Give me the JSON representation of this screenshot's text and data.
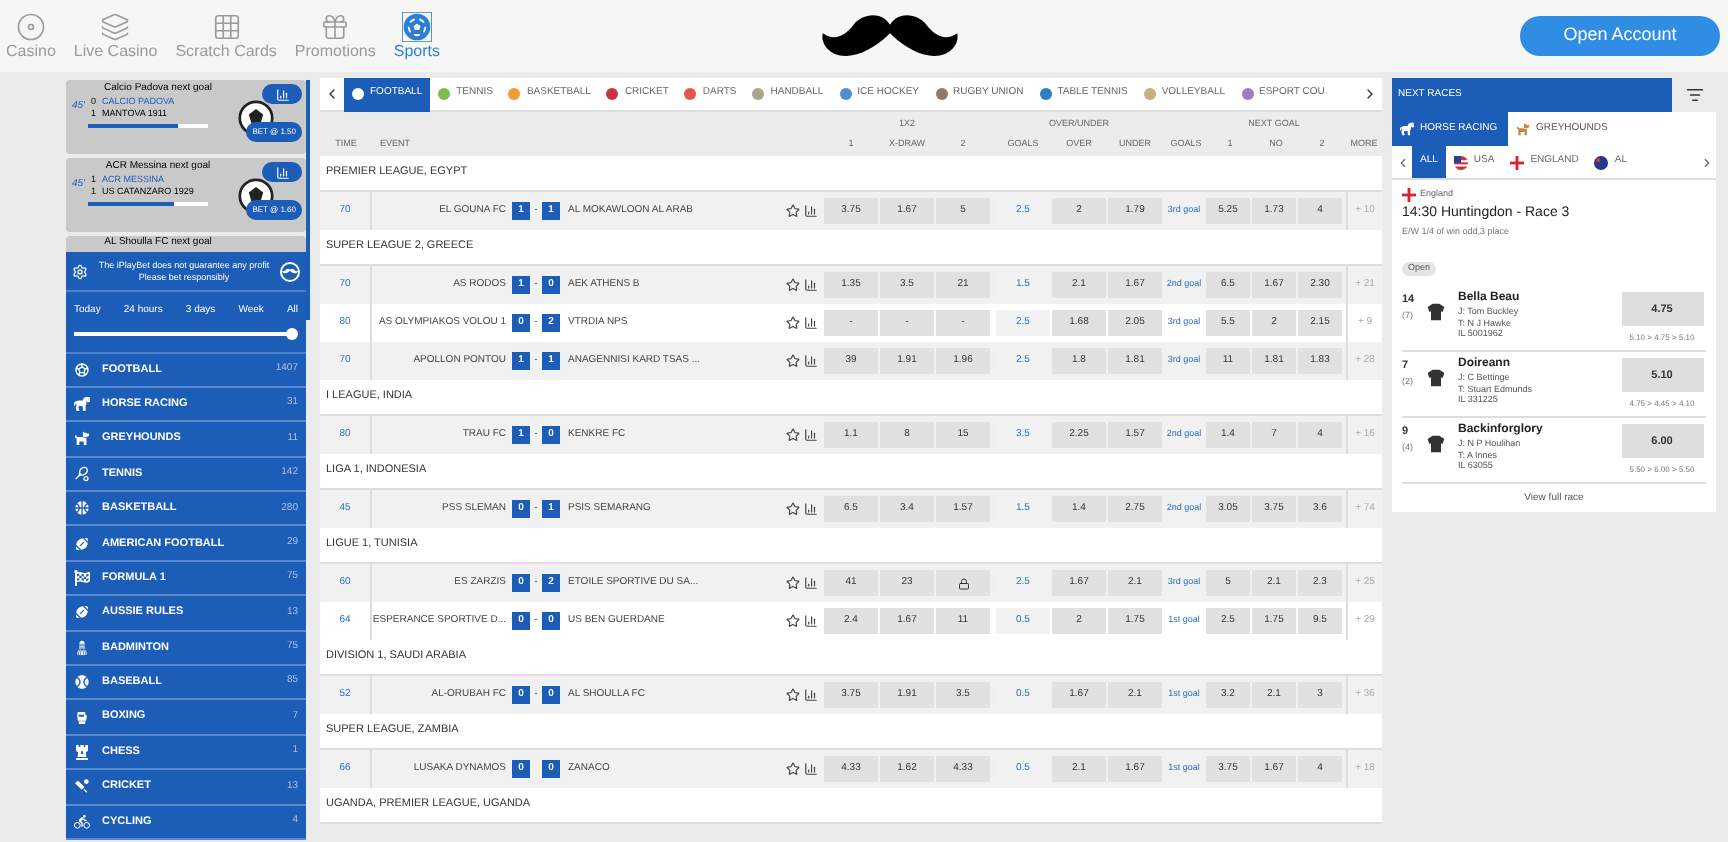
{
  "top_nav": [
    {
      "label": "Casino",
      "kind": "casino",
      "selected": false
    },
    {
      "label": "Live Casino",
      "kind": "cards",
      "selected": false
    },
    {
      "label": "Scratch Cards",
      "kind": "grid",
      "selected": false
    },
    {
      "label": "Promotions",
      "kind": "gift",
      "selected": false
    },
    {
      "label": "Sports",
      "kind": "sports",
      "selected": true
    }
  ],
  "open_account": "Open Account",
  "live_widgets": [
    {
      "title": "Calcio Padova next goal",
      "minute": "45'",
      "home_score": "0",
      "home": "CALCIO PADOVA",
      "away_score": "1",
      "away": "MANTOVA 1911",
      "bet": "BET @ 1.50",
      "level": 0.75
    },
    {
      "title": "ACR Messina next goal",
      "minute": "45'",
      "home_score": "1",
      "home": "ACR MESSINA",
      "away_score": "1",
      "away": "US CATANZARO 1929",
      "bet": "BET @ 1.60",
      "level": 0.72
    }
  ],
  "covered_widget": {
    "title": "AL Shoulla FC next goal"
  },
  "notice": "The iPlayBet does not guarantee any profit Please bet responsibly",
  "time_filter": {
    "options": [
      "Today",
      "24 hours",
      "3 days",
      "Week",
      "All"
    ],
    "level": 1
  },
  "sports": [
    {
      "label": "FOOTBALL",
      "count": "1407",
      "kind": "football"
    },
    {
      "label": "HORSE RACING",
      "count": "31",
      "kind": "horse"
    },
    {
      "label": "GREYHOUNDS",
      "count": "11",
      "kind": "dog"
    },
    {
      "label": "TENNIS",
      "count": "142",
      "kind": "tennis"
    },
    {
      "label": "BASKETBALL",
      "count": "280",
      "kind": "basketball"
    },
    {
      "label": "AMERICAN FOOTBALL",
      "count": "29",
      "kind": "rugby"
    },
    {
      "label": "FORMULA 1",
      "count": "75",
      "kind": "flag"
    },
    {
      "label": "AUSSIE RULES",
      "count": "13",
      "kind": "rugby"
    },
    {
      "label": "BADMINTON",
      "count": "75",
      "kind": "shuttle"
    },
    {
      "label": "BASEBALL",
      "count": "85",
      "kind": "baseball"
    },
    {
      "label": "BOXING",
      "count": "7",
      "kind": "boxing"
    },
    {
      "label": "CHESS",
      "count": "1",
      "kind": "chess"
    },
    {
      "label": "CRICKET",
      "count": "13",
      "kind": "cricket"
    },
    {
      "label": "CYCLING",
      "count": "4",
      "kind": "cycling"
    }
  ],
  "sport_tabs": [
    {
      "label": "FOOTBALL",
      "selected": true,
      "color": "#ffffff"
    },
    {
      "label": "TENNIS",
      "selected": false,
      "color": "#7cc04b"
    },
    {
      "label": "BASKETBALL",
      "selected": false,
      "color": "#f39a34"
    },
    {
      "label": "CRICKET",
      "selected": false,
      "color": "#cc3340"
    },
    {
      "label": "DARTS",
      "selected": false,
      "color": "#e2564f"
    },
    {
      "label": "HANDBALL",
      "selected": false,
      "color": "#a8a58a"
    },
    {
      "label": "ICE HOCKEY",
      "selected": false,
      "color": "#4f8fd0"
    },
    {
      "label": "RUGBY UNION",
      "selected": false,
      "color": "#8d7a6a"
    },
    {
      "label": "TABLE TENNIS",
      "selected": false,
      "color": "#2e7fc1"
    },
    {
      "label": "VOLLEYBALL",
      "selected": false,
      "color": "#c8b07a"
    },
    {
      "label": "ESPORT COU",
      "selected": false,
      "color": "#9b7cc0"
    }
  ],
  "column_groups": [
    "1X2",
    "OVER/UNDER",
    "NEXT GOAL"
  ],
  "columns": [
    "TIME",
    "EVENT",
    "1",
    "X-DRAW",
    "2",
    "GOALS",
    "OVER",
    "UNDER",
    "GOALS",
    "1",
    "NO",
    "2",
    "MORE"
  ],
  "leagues": [
    {
      "name": "PREMIER LEAGUE, EGYPT",
      "matches": [
        {
          "time": "70",
          "home": "EL GOUNA FC",
          "score_home": "1",
          "separator": "-",
          "score_away": "1",
          "away": "AL MOKAWLOON AL ARAB",
          "odds": [
            {
              "value": "3.75",
              "locked": false
            },
            {
              "value": "1.67",
              "locked": false
            },
            {
              "value": "5",
              "locked": false
            }
          ],
          "goals": "2.5",
          "over": "2",
          "under": "1.79",
          "next_goal": "3rd goal",
          "next": [
            "5.25",
            "1.73",
            "4"
          ],
          "more": "+ 10"
        }
      ]
    },
    {
      "name": "SUPER LEAGUE 2, GREECE",
      "matches": [
        {
          "time": "70",
          "home": "AS RODOS",
          "score_home": "1",
          "separator": "-",
          "score_away": "0",
          "away": "AEK ATHENS B",
          "odds": [
            {
              "value": "1.35",
              "locked": false
            },
            {
              "value": "3.5",
              "locked": false
            },
            {
              "value": "21",
              "locked": false
            }
          ],
          "goals": "1.5",
          "over": "2.1",
          "under": "1.67",
          "next_goal": "2nd goal",
          "next": [
            "6.5",
            "1.67",
            "2.30"
          ],
          "more": "+ 21"
        },
        {
          "time": "80",
          "home": "AS OLYMPIAKOS VOLOU 1",
          "score_home": "0",
          "separator": "-",
          "score_away": "2",
          "away": "VTRDIA NPS",
          "odds": [
            {
              "value": "-",
              "locked": false
            },
            {
              "value": "-",
              "locked": false
            },
            {
              "value": "-",
              "locked": false
            }
          ],
          "goals": "2.5",
          "over": "1.68",
          "under": "2.05",
          "next_goal": "3rd goal",
          "next": [
            "5.5",
            "2",
            "2.15"
          ],
          "more": "+ 9"
        },
        {
          "time": "70",
          "home": "APOLLON PONTOU",
          "score_home": "1",
          "separator": "-",
          "score_away": "1",
          "away": "ANAGENNISI KARD TSAS ...",
          "odds": [
            {
              "value": "39",
              "locked": false
            },
            {
              "value": "1.91",
              "locked": false
            },
            {
              "value": "1.96",
              "locked": false
            }
          ],
          "goals": "2.5",
          "over": "1.8",
          "under": "1.81",
          "next_goal": "3rd goal",
          "next": [
            "11",
            "1.81",
            "1.83"
          ],
          "more": "+ 28"
        }
      ]
    },
    {
      "name": "I LEAGUE, INDIA",
      "matches": [
        {
          "time": "80",
          "home": "TRAU FC",
          "score_home": "1",
          "separator": "-",
          "score_away": "0",
          "away": "KENKRE FC",
          "odds": [
            {
              "value": "1.1",
              "locked": false
            },
            {
              "value": "8",
              "locked": false
            },
            {
              "value": "15",
              "locked": false
            }
          ],
          "goals": "3.5",
          "over": "2.25",
          "under": "1.57",
          "next_goal": "2nd goal",
          "next": [
            "1.4",
            "7",
            "4"
          ],
          "more": "+ 16"
        }
      ]
    },
    {
      "name": "LIGA 1, INDONESIA",
      "matches": [
        {
          "time": "45",
          "home": "PSS SLEMAN",
          "score_home": "0",
          "separator": "-",
          "score_away": "1",
          "away": "PSIS SEMARANG",
          "odds": [
            {
              "value": "6.5",
              "locked": false
            },
            {
              "value": "3.4",
              "locked": false
            },
            {
              "value": "1.57",
              "locked": false
            }
          ],
          "goals": "1.5",
          "over": "1.4",
          "under": "2.75",
          "next_goal": "2nd goal",
          "next": [
            "3.05",
            "3.75",
            "3.6"
          ],
          "more": "+ 74"
        }
      ]
    },
    {
      "name": "LIGUE 1, TUNISIA",
      "matches": [
        {
          "time": "60",
          "home": "ES ZARZIS",
          "score_home": "0",
          "separator": "-",
          "score_away": "2",
          "away": "ETOILE SPORTIVE DU SA...",
          "odds": [
            {
              "value": "41",
              "locked": false
            },
            {
              "value": "23",
              "locked": false
            },
            {
              "locked": true
            }
          ],
          "goals": "2.5",
          "over": "1.67",
          "under": "2.1",
          "next_goal": "3rd goal",
          "next": [
            "5",
            "2.1",
            "2.3"
          ],
          "more": "+ 25"
        },
        {
          "time": "64",
          "home": "ESPERANCE SPORTIVE D...",
          "score_home": "0",
          "separator": "-",
          "score_away": "0",
          "away": "US BEN GUERDANE",
          "odds": [
            {
              "value": "2.4",
              "locked": false
            },
            {
              "value": "1.67",
              "locked": false
            },
            {
              "value": "11",
              "locked": false
            }
          ],
          "goals": "0.5",
          "over": "2",
          "under": "1.75",
          "next_goal": "1st goal",
          "next": [
            "2.5",
            "1.75",
            "9.5"
          ],
          "more": "+ 29"
        }
      ]
    },
    {
      "name": "DIVISION 1, SAUDI ARABIA",
      "matches": [
        {
          "time": "52",
          "home": "AL-ORUBAH FC",
          "score_home": "0",
          "separator": "-",
          "score_away": "0",
          "away": "AL SHOULLA FC",
          "odds": [
            {
              "value": "3.75",
              "locked": false
            },
            {
              "value": "1.91",
              "locked": false
            },
            {
              "value": "3.5",
              "locked": false
            }
          ],
          "goals": "0.5",
          "over": "1.67",
          "under": "2.1",
          "next_goal": "1st goal",
          "next": [
            "3.2",
            "2.1",
            "3"
          ],
          "more": "+ 36"
        }
      ]
    },
    {
      "name": "SUPER LEAGUE, ZAMBIA",
      "matches": [
        {
          "time": "66",
          "home": "LUSAKA DYNAMOS",
          "score_home": "0",
          "score_away": "0",
          "away": "ZANACO",
          "odds": [
            {
              "value": "4.33",
              "locked": false
            },
            {
              "value": "1.62",
              "locked": false
            },
            {
              "value": "4.33",
              "locked": false
            }
          ],
          "goals": "0.5",
          "over": "2.1",
          "under": "1.67",
          "next_goal": "1st goal",
          "next": [
            "3.75",
            "1.67",
            "4"
          ],
          "more": "+ 18"
        }
      ]
    },
    {
      "name": "UGANDA, PREMIER LEAGUE, UGANDA"
    }
  ],
  "next_races": {
    "title": "NEXT RACES",
    "race_tabs": [
      {
        "label": "HORSE RACING",
        "kind": "horse",
        "selected": true
      },
      {
        "label": "GREYHOUNDS",
        "kind": "dog",
        "selected": false
      }
    ],
    "countries": [
      {
        "label": "ALL",
        "kind": "none",
        "selected": true
      },
      {
        "label": "USA",
        "kind": "usa",
        "selected": false
      },
      {
        "label": "ENGLAND",
        "kind": "england",
        "selected": false
      },
      {
        "label": "AL",
        "kind": "australia",
        "selected": false
      }
    ],
    "race": {
      "country": "England",
      "title": "14:30 Huntingdon - Race 3",
      "terms": "E/W 1/4 of win odd,3 place",
      "status": "Open"
    },
    "runners": [
      {
        "number": "14",
        "draw": "(7)",
        "name": "Bella Beau",
        "jockey": "J: Tom Buckley",
        "trainer": "T: N J Hawke",
        "form": "IL 5001962",
        "odds": "4.75",
        "history": "5.10 > 4.75 > 5.10"
      },
      {
        "number": "7",
        "draw": "(2)",
        "name": "Doireann",
        "jockey": "J: C Bettinge",
        "trainer": "T: Stuart Edmunds",
        "form": "IL 331225",
        "odds": "5.10",
        "history": "4.75 > 4.45 > 4.10"
      },
      {
        "number": "9",
        "draw": "(4)",
        "name": "Backinforglory",
        "jockey": "J: N P Houlihan",
        "trainer": "T: A Innes",
        "form": "IL 63055",
        "odds": "6.00",
        "history": "5.50 > 6.00 > 5.50"
      }
    ],
    "view_full": "View full race"
  }
}
